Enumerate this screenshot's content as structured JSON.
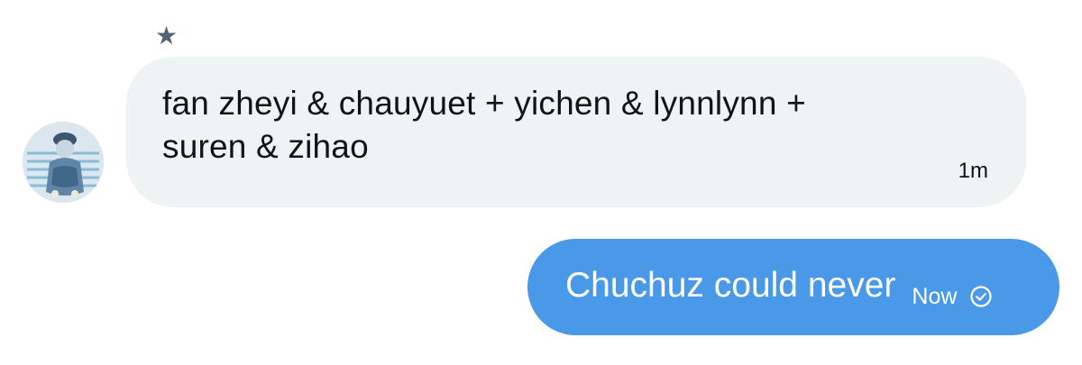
{
  "conversation": {
    "star_glyph": "★",
    "incoming": {
      "text": "fan zheyi & chauyuet + yichen & lynnlynn + suren & zihao",
      "time": "1m",
      "avatar_icon": "user-avatar"
    },
    "outgoing": {
      "text": "Chuchuz could never",
      "time": "Now",
      "status_icon": "check-circle-icon"
    }
  },
  "colors": {
    "incoming_bubble": "#eff3f4",
    "outgoing_bubble": "#4a99e9",
    "text_dark": "#0f1419",
    "text_light": "#ffffff",
    "star": "#536471"
  }
}
